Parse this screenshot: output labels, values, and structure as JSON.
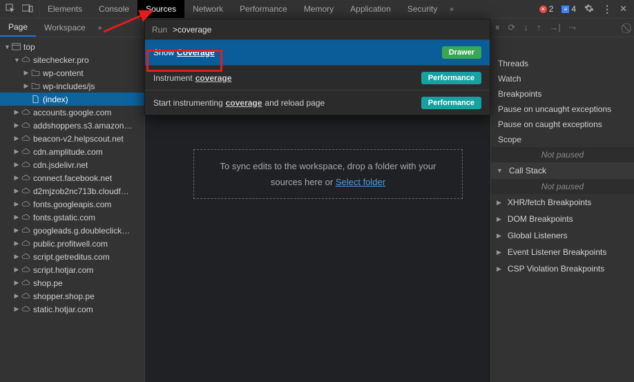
{
  "topTabs": [
    "Elements",
    "Console",
    "Sources",
    "Network",
    "Performance",
    "Memory",
    "Application",
    "Security"
  ],
  "activeTopTab": "Sources",
  "errors": {
    "count": "2"
  },
  "info": {
    "count": "4"
  },
  "subTabs": [
    "Page",
    "Workspace"
  ],
  "activeSubTab": "Page",
  "tree": [
    {
      "depth": 0,
      "icon": "frame",
      "label": "top",
      "expanded": true
    },
    {
      "depth": 1,
      "icon": "cloud",
      "label": "sitechecker.pro",
      "expanded": true
    },
    {
      "depth": 2,
      "icon": "folder",
      "label": "wp-content",
      "expanded": false,
      "arrow": "right"
    },
    {
      "depth": 2,
      "icon": "folder",
      "label": "wp-includes/js",
      "expanded": false,
      "arrow": "right"
    },
    {
      "depth": 2,
      "icon": "file",
      "label": "(index)",
      "selected": true,
      "noarrow": true
    },
    {
      "depth": 1,
      "icon": "cloud",
      "label": "accounts.google.com",
      "arrow": "right"
    },
    {
      "depth": 1,
      "icon": "cloud",
      "label": "addshoppers.s3.amazon…",
      "arrow": "right"
    },
    {
      "depth": 1,
      "icon": "cloud",
      "label": "beacon-v2.helpscout.net",
      "arrow": "right"
    },
    {
      "depth": 1,
      "icon": "cloud",
      "label": "cdn.amplitude.com",
      "arrow": "right"
    },
    {
      "depth": 1,
      "icon": "cloud",
      "label": "cdn.jsdelivr.net",
      "arrow": "right"
    },
    {
      "depth": 1,
      "icon": "cloud",
      "label": "connect.facebook.net",
      "arrow": "right"
    },
    {
      "depth": 1,
      "icon": "cloud",
      "label": "d2mjzob2nc713b.cloudf…",
      "arrow": "right"
    },
    {
      "depth": 1,
      "icon": "cloud",
      "label": "fonts.googleapis.com",
      "arrow": "right"
    },
    {
      "depth": 1,
      "icon": "cloud",
      "label": "fonts.gstatic.com",
      "arrow": "right"
    },
    {
      "depth": 1,
      "icon": "cloud",
      "label": "googleads.g.doubleclick…",
      "arrow": "right"
    },
    {
      "depth": 1,
      "icon": "cloud",
      "label": "public.profitwell.com",
      "arrow": "right"
    },
    {
      "depth": 1,
      "icon": "cloud",
      "label": "script.getreditus.com",
      "arrow": "right"
    },
    {
      "depth": 1,
      "icon": "cloud",
      "label": "script.hotjar.com",
      "arrow": "right"
    },
    {
      "depth": 1,
      "icon": "cloud",
      "label": "shop.pe",
      "arrow": "right"
    },
    {
      "depth": 1,
      "icon": "cloud",
      "label": "shopper.shop.pe",
      "arrow": "right"
    },
    {
      "depth": 1,
      "icon": "cloud",
      "label": "static.hotjar.com",
      "arrow": "right"
    }
  ],
  "dropzone": {
    "line1": "To sync edits to the workspace, drop a folder with your",
    "line2pre": "sources here or ",
    "link": "Select folder"
  },
  "cmd": {
    "prefix": "Run",
    "prompt": ">",
    "query": "coverage",
    "items": [
      {
        "pre": "Show ",
        "match": "Coverage",
        "post": "",
        "badge": "Drawer",
        "badgeClass": "drawer",
        "selected": true
      },
      {
        "pre": "Instrument ",
        "match": "coverage",
        "post": "",
        "badge": "Performance",
        "badgeClass": "perf"
      },
      {
        "pre": "Start instrumenting ",
        "match": "coverage",
        "post": " and reload page",
        "badge": "Performance",
        "badgeClass": "perf"
      }
    ]
  },
  "rightToolbarIcons": [
    "⏸",
    "⟳",
    "↓",
    "↑",
    "→|",
    "⤳"
  ],
  "rightMiscIcon": "⃠",
  "rightSections": {
    "listTop": [
      "Threads",
      "Watch",
      "Breakpoints",
      "Pause on uncaught exceptions",
      "Pause on caught exceptions",
      "Scope"
    ],
    "notPaused": "Not paused",
    "callStack": "Call Stack",
    "bp": [
      "XHR/fetch Breakpoints",
      "DOM Breakpoints",
      "Global Listeners",
      "Event Listener Breakpoints",
      "CSP Violation Breakpoints"
    ]
  }
}
